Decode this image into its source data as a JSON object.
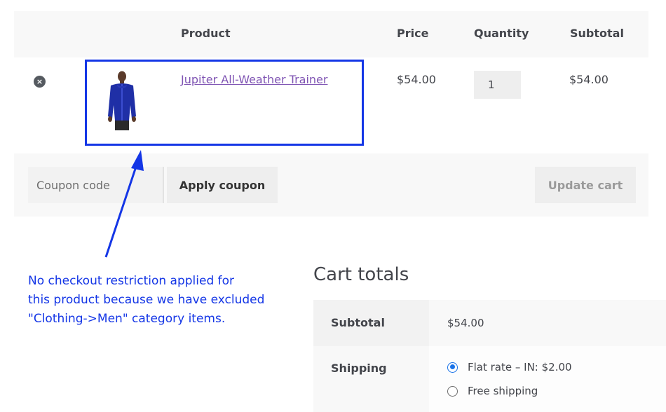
{
  "cart_table": {
    "headers": {
      "product": "Product",
      "price": "Price",
      "quantity": "Quantity",
      "subtotal": "Subtotal"
    },
    "rows": [
      {
        "remove_icon": "remove-circle-x-icon",
        "product_name": "Jupiter All-Weather Trainer",
        "price": "$54.00",
        "quantity": "1",
        "subtotal": "$54.00"
      }
    ]
  },
  "actions": {
    "coupon_placeholder": "Coupon code",
    "apply_coupon_label": "Apply coupon",
    "update_cart_label": "Update cart"
  },
  "annotation": {
    "line1": "No checkout restriction applied for",
    "line2": "this product because we have excluded",
    "line3": "\"Clothing->Men\" category items.",
    "color": "#1436e6"
  },
  "cart_totals": {
    "title": "Cart totals",
    "subtotal_label": "Subtotal",
    "subtotal_value": "$54.00",
    "shipping_label": "Shipping",
    "shipping_options": [
      {
        "label": "Flat rate – IN: $2.00",
        "selected": true
      },
      {
        "label": "Free shipping",
        "selected": false
      }
    ]
  },
  "colors": {
    "link": "#7f54b3",
    "radio_accent": "#1a73e8",
    "table_bg": "#f8f8f8"
  }
}
